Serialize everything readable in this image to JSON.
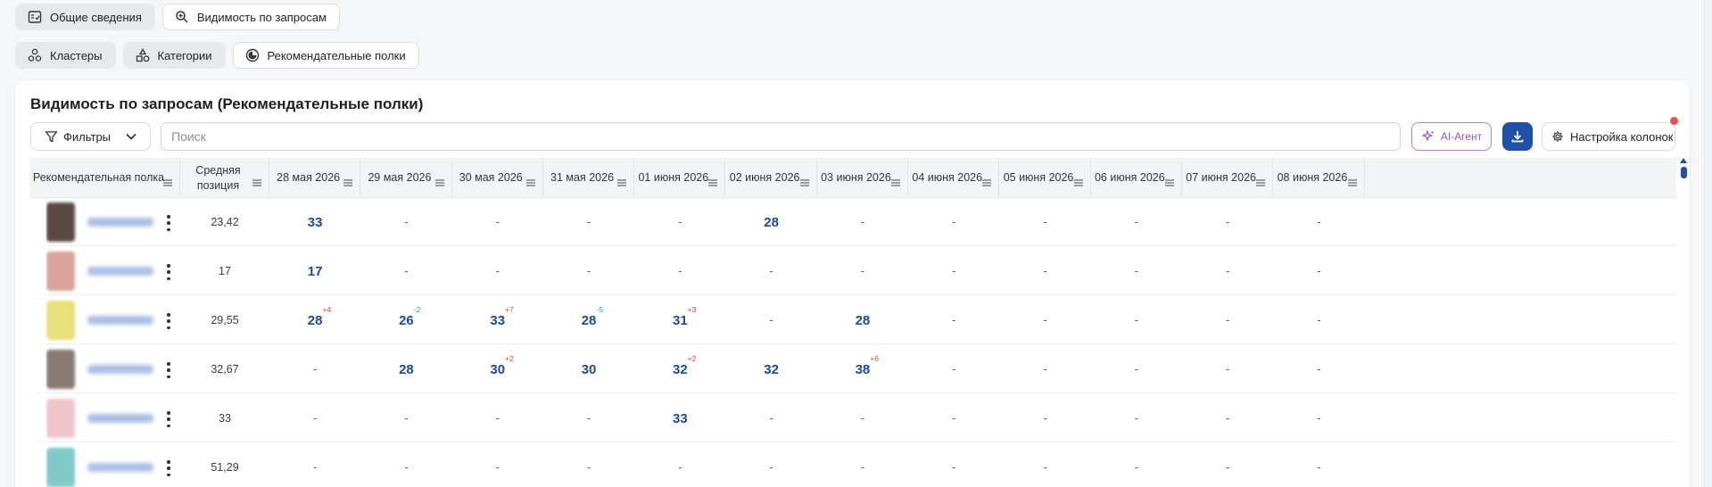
{
  "tabs_row1": [
    {
      "label": "Общие сведения",
      "icon": "report-icon",
      "active": true
    },
    {
      "label": "Видимость по запросам",
      "icon": "search-zoom-icon",
      "active": false
    }
  ],
  "tabs_row2": [
    {
      "label": "Кластеры",
      "icon": "clusters-icon",
      "active": true
    },
    {
      "label": "Категории",
      "icon": "categories-icon",
      "active": true
    },
    {
      "label": "Рекомендательные полки",
      "icon": "shelves-icon",
      "active": false
    }
  ],
  "card": {
    "title": "Видимость по запросам (Рекомендательные полки)",
    "filters_label": "Фильтры",
    "search_placeholder": "Поиск",
    "ai_label": "AI-Агент",
    "columns_label": "Настройка колонок"
  },
  "table": {
    "headers": {
      "shelf": "Рекомендательная полка",
      "avg_position": "Средняя позиция",
      "dates": [
        "28 мая 2026",
        "29 мая 2026",
        "30 мая 2026",
        "31 мая 2026",
        "01 июня 2026",
        "02 июня 2026",
        "03 июня 2026",
        "04 июня 2026",
        "05 июня 2026",
        "06 июня 2026",
        "07 июня 2026",
        "08 июня 2026"
      ]
    },
    "rows": [
      {
        "avg": "23,42",
        "thumb_color": "#5b4a44",
        "cells": [
          {
            "v": "33"
          },
          {
            "v": "-"
          },
          {
            "v": "-"
          },
          {
            "v": "-"
          },
          {
            "v": "-"
          },
          {
            "v": "28"
          },
          {
            "v": "-"
          },
          {
            "v": "-"
          },
          {
            "v": "-"
          },
          {
            "v": "-"
          },
          {
            "v": "-"
          },
          {
            "v": "-"
          }
        ]
      },
      {
        "avg": "17",
        "thumb_color": "#d9a39a",
        "cells": [
          {
            "v": "17"
          },
          {
            "v": "-"
          },
          {
            "v": "-"
          },
          {
            "v": "-"
          },
          {
            "v": "-"
          },
          {
            "v": "-"
          },
          {
            "v": "-"
          },
          {
            "v": "-"
          },
          {
            "v": "-"
          },
          {
            "v": "-"
          },
          {
            "v": "-"
          },
          {
            "v": "-"
          }
        ]
      },
      {
        "avg": "29,55",
        "thumb_color": "#e8e07a",
        "cells": [
          {
            "v": "28",
            "d": "+4",
            "dir": "up"
          },
          {
            "v": "26",
            "d": "-2",
            "dir": "down"
          },
          {
            "v": "33",
            "d": "+7",
            "dir": "up"
          },
          {
            "v": "28",
            "d": "-5",
            "dir": "down"
          },
          {
            "v": "31",
            "d": "+3",
            "dir": "up"
          },
          {
            "v": "-"
          },
          {
            "v": "28"
          },
          {
            "v": "-"
          },
          {
            "v": "-"
          },
          {
            "v": "-"
          },
          {
            "v": "-"
          },
          {
            "v": "-"
          }
        ]
      },
      {
        "avg": "32,67",
        "thumb_color": "#8a7b74",
        "cells": [
          {
            "v": "-"
          },
          {
            "v": "28"
          },
          {
            "v": "30",
            "d": "+2",
            "dir": "up"
          },
          {
            "v": "30"
          },
          {
            "v": "32",
            "d": "+2",
            "dir": "up"
          },
          {
            "v": "32"
          },
          {
            "v": "38",
            "d": "+6",
            "dir": "up"
          },
          {
            "v": "-"
          },
          {
            "v": "-"
          },
          {
            "v": "-"
          },
          {
            "v": "-"
          },
          {
            "v": "-"
          }
        ]
      },
      {
        "avg": "33",
        "thumb_color": "#f0c6cc",
        "cells": [
          {
            "v": "-"
          },
          {
            "v": "-"
          },
          {
            "v": "-"
          },
          {
            "v": "-"
          },
          {
            "v": "33"
          },
          {
            "v": "-"
          },
          {
            "v": "-"
          },
          {
            "v": "-"
          },
          {
            "v": "-"
          },
          {
            "v": "-"
          },
          {
            "v": "-"
          },
          {
            "v": "-"
          }
        ]
      },
      {
        "avg": "51,29",
        "thumb_color": "#7fc9c9",
        "cells": [
          {
            "v": "-"
          },
          {
            "v": "-"
          },
          {
            "v": "-"
          },
          {
            "v": "-"
          },
          {
            "v": "-"
          },
          {
            "v": "-"
          },
          {
            "v": "-"
          },
          {
            "v": "-"
          },
          {
            "v": "-"
          },
          {
            "v": "-"
          },
          {
            "v": "-"
          },
          {
            "v": "-"
          }
        ]
      }
    ]
  },
  "colors": {
    "accent": "#1f4fa8",
    "value": "#1a4a9c",
    "delta_up": "#e0433b",
    "delta_down": "#19a88a",
    "ai": "#9a4fd6"
  }
}
